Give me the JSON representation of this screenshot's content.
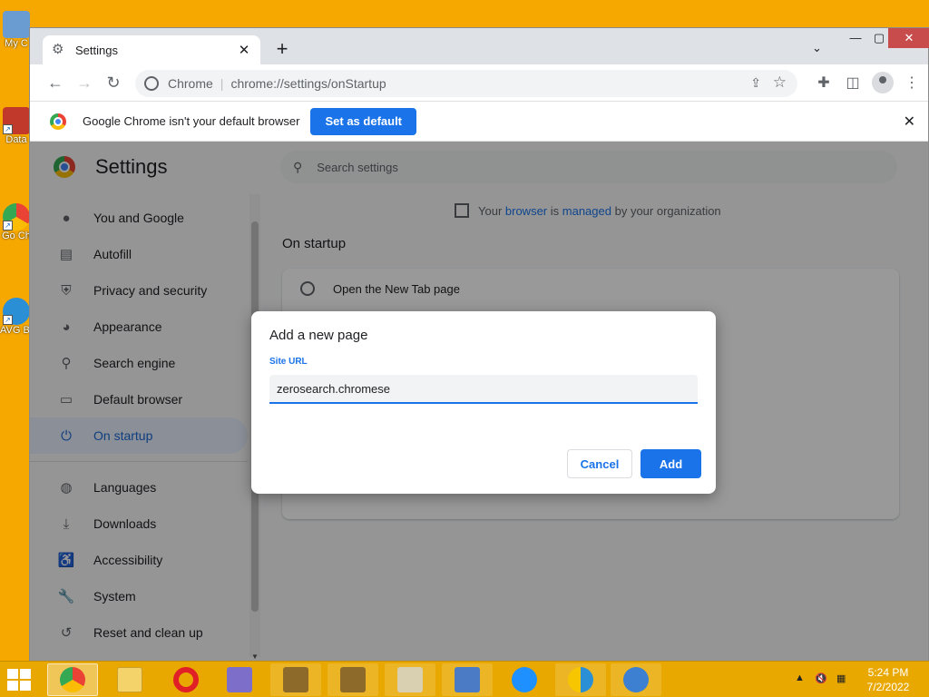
{
  "desktop": {
    "icons": [
      {
        "label": "My C",
        "icon": "computer-icon"
      },
      {
        "label": "Data",
        "icon": "shortcut-icon"
      },
      {
        "label": "Go Ch",
        "icon": "chrome-shortcut-icon"
      },
      {
        "label": "AVG Br",
        "icon": "avg-browser-icon"
      }
    ]
  },
  "browser": {
    "tab": {
      "title": "Settings",
      "icon": "gear-icon"
    },
    "omnibox": {
      "origin": "Chrome",
      "url": "chrome://settings/onStartup"
    },
    "infobar": {
      "message": "Google Chrome isn't your default browser",
      "button": "Set as default"
    }
  },
  "settings": {
    "title": "Settings",
    "search_placeholder": "Search settings",
    "nav": [
      {
        "label": "You and Google",
        "icon": "person-icon"
      },
      {
        "label": "Autofill",
        "icon": "clipboard-icon"
      },
      {
        "label": "Privacy and security",
        "icon": "shield-icon"
      },
      {
        "label": "Appearance",
        "icon": "palette-icon"
      },
      {
        "label": "Search engine",
        "icon": "search-icon"
      },
      {
        "label": "Default browser",
        "icon": "browser-icon"
      },
      {
        "label": "On startup",
        "icon": "power-icon",
        "active": true
      },
      {
        "label": "Languages",
        "icon": "globe-icon"
      },
      {
        "label": "Downloads",
        "icon": "download-icon"
      },
      {
        "label": "Accessibility",
        "icon": "accessibility-icon"
      },
      {
        "label": "System",
        "icon": "wrench-icon"
      },
      {
        "label": "Reset and clean up",
        "icon": "history-icon"
      }
    ],
    "managed": {
      "prefix": "Your ",
      "link1": "browser",
      "mid": " is ",
      "link2": "managed",
      "suffix": " by your organization"
    },
    "section_title": "On startup",
    "option": "Open the New Tab page"
  },
  "dialog": {
    "title": "Add a new page",
    "field_label": "Site URL",
    "field_value": "zerosearch.chromese",
    "cancel": "Cancel",
    "add": "Add"
  },
  "taskbar": {
    "apps": [
      "chrome",
      "file-explorer",
      "opera",
      "app-a",
      "key-app-1",
      "key-app-2",
      "archive",
      "certificate",
      "internet-explorer",
      "avg-secure-browser",
      "qbittorrent"
    ],
    "time": "5:24 PM",
    "date": "7/2/2022"
  },
  "colors": {
    "accent": "#1a73e8",
    "desktop": "#f6a800",
    "close_button": "#c94c4c"
  }
}
